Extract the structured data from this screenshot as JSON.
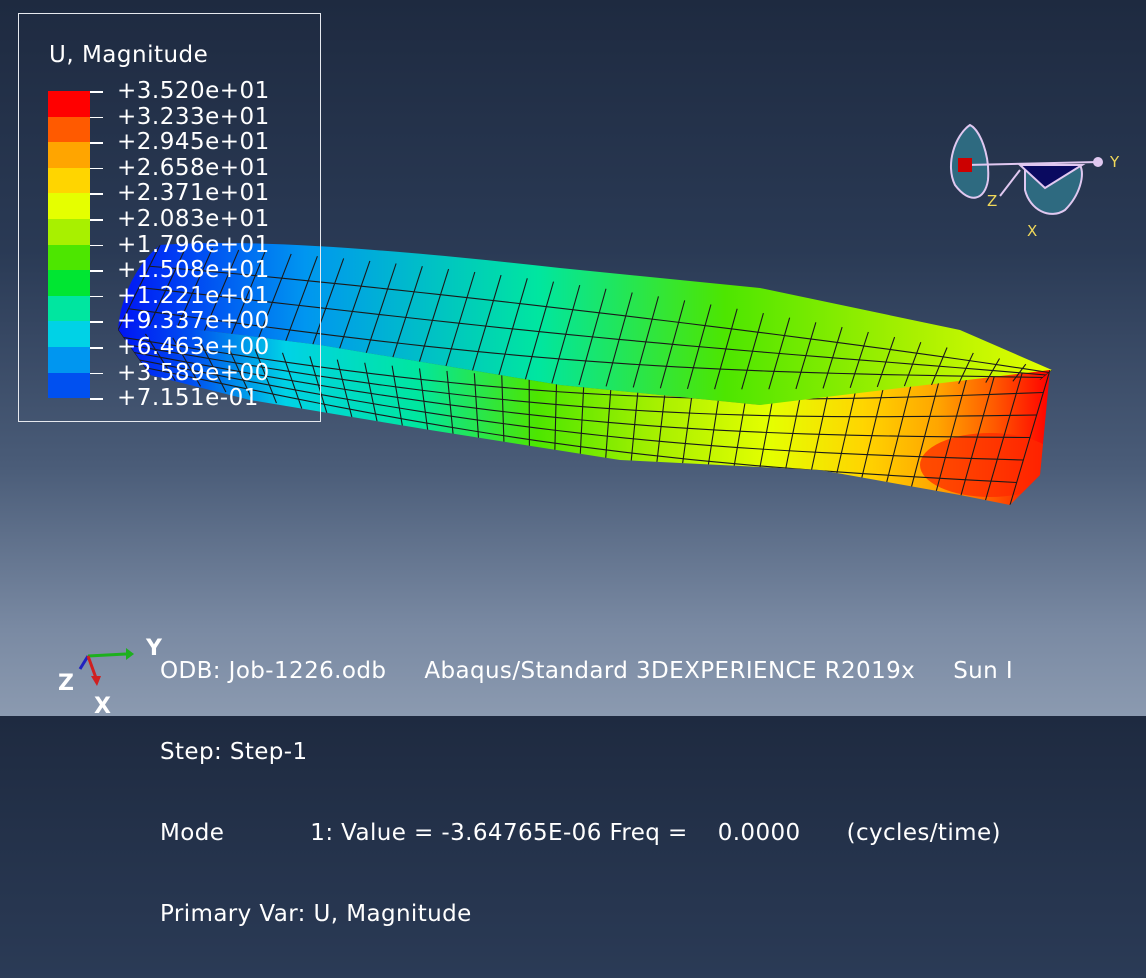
{
  "legend": {
    "title": "U, Magnitude",
    "labels": [
      "+3.520e+01",
      "+3.233e+01",
      "+2.945e+01",
      "+2.658e+01",
      "+2.371e+01",
      "+2.083e+01",
      "+1.796e+01",
      "+1.508e+01",
      "+1.221e+01",
      "+9.337e+00",
      "+6.463e+00",
      "+3.589e+00",
      "+7.151e-01"
    ],
    "colors": [
      "#ff0000",
      "#ff5a00",
      "#ffa500",
      "#ffd500",
      "#e5ff00",
      "#a8f000",
      "#4de600",
      "#00e632",
      "#00e6a0",
      "#00d2e6",
      "#0096f0",
      "#0050f0",
      "#0014f5"
    ]
  },
  "triad": {
    "x_label": "X",
    "y_label": "Y",
    "z_label": "Z"
  },
  "info": {
    "line1_a": "ODB: Job-1226.odb",
    "line1_b": "Abaqus/Standard 3DEXPERIENCE R2019x",
    "line1_c": "Sun I",
    "line2": "Step: Step-1",
    "line3_a": "Mode",
    "line3_b": "1: Value = -3.64765E-06 Freq =",
    "line3_c": "0.0000",
    "line3_d": "(cycles/time)",
    "line4": "Primary Var: U, Magnitude"
  },
  "mini_triad": {
    "y_label": "Y",
    "z_label": "Z",
    "x_label": "X"
  }
}
